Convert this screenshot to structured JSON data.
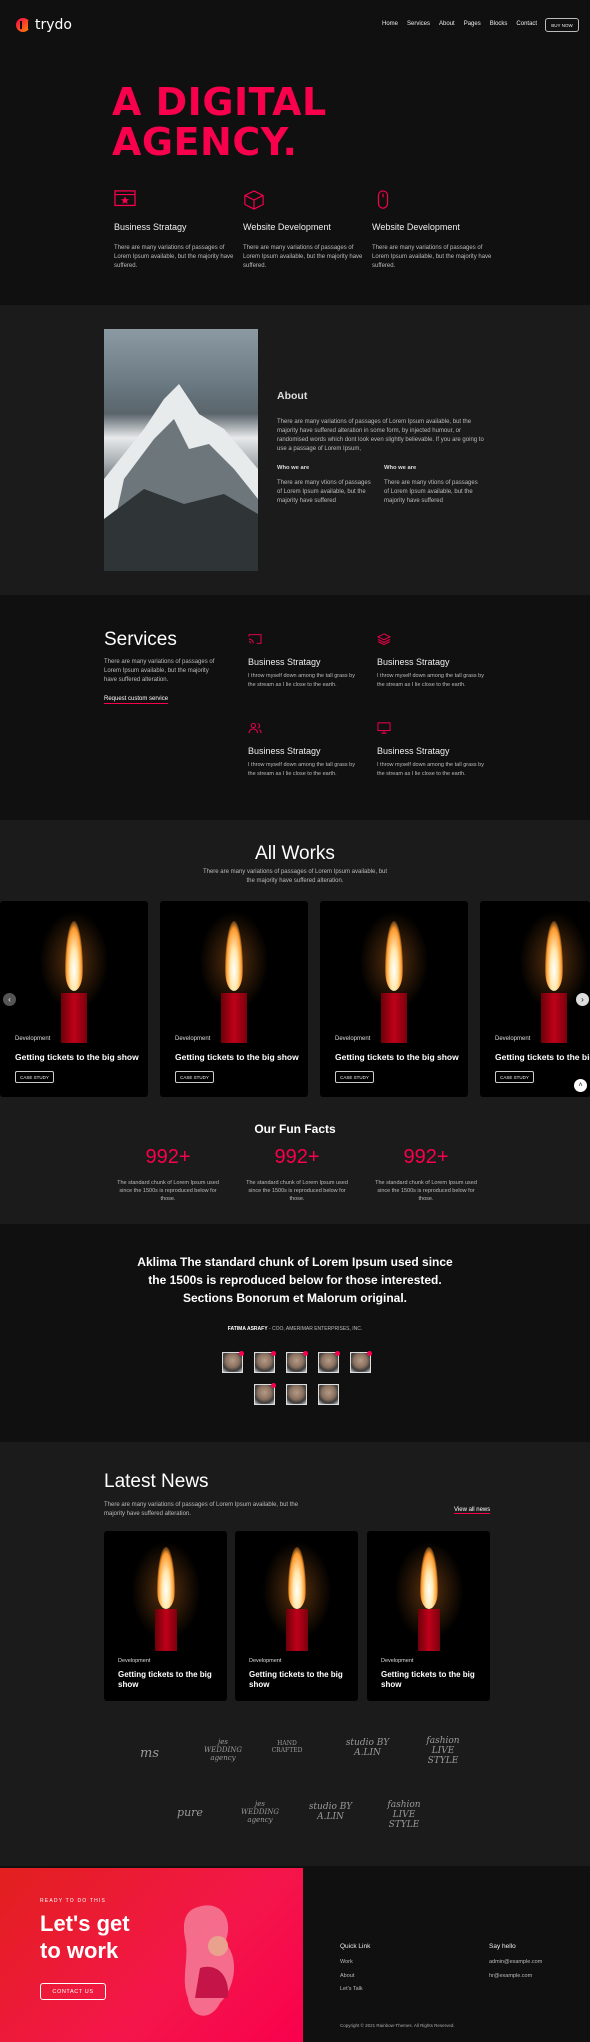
{
  "brand": {
    "logo_text": "trydo",
    "accent": "#f9004d"
  },
  "nav": {
    "items": [
      "Home",
      "Services",
      "About",
      "Pages",
      "Blocks",
      "Contact"
    ],
    "cta": "BUY NOW"
  },
  "hero": {
    "title_line1": "A DIGITAL",
    "title_line2": "AGENCY.",
    "features": [
      {
        "icon": "monitor-star-icon",
        "title": "Business Stratagy",
        "text": "There are many variations of passages of Lorem Ipsum available, but the majority have suffered."
      },
      {
        "icon": "cube-icon",
        "title": "Website Development",
        "text": "There are many variations of passages of Lorem Ipsum available, but the majority have suffered."
      },
      {
        "icon": "mouse-icon",
        "title": "Website Development",
        "text": "There are many variations of passages of Lorem Ipsum available, but the majority have suffered."
      }
    ]
  },
  "about": {
    "title": "About",
    "text": "There are many variations of passages of Lorem Ipsum available, but the majority have suffered alteration in some form, by injected humour, or randomised words which dont look even slightly believable. If you are going to use a passage of Lorem Ipsum,",
    "cols": [
      {
        "title": "Who we are",
        "text": "There are many vtions of passages of Lorem Ipsum available, but the majority have suffered"
      },
      {
        "title": "Who we are",
        "text": "There are many vtions of passages of Lorem Ipsum available, but the majority have suffered"
      }
    ]
  },
  "services": {
    "title": "Services",
    "text": "There are many variations of passages of Lorem Ipsum available, but the majority have suffered alteration.",
    "link": "Request custom service",
    "items": [
      {
        "icon": "cast-icon",
        "title": "Business Stratagy",
        "text": "I throw myself down among the tall grass by the stream as I lie close to the earth."
      },
      {
        "icon": "layers-icon",
        "title": "Business Stratagy",
        "text": "I throw myself down among the tall grass by the stream as I lie close to the earth."
      },
      {
        "icon": "users-icon",
        "title": "Business Stratagy",
        "text": "I throw myself down among the tall grass by the stream as I lie close to the earth."
      },
      {
        "icon": "monitor-icon",
        "title": "Business Stratagy",
        "text": "I throw myself down among the tall grass by the stream as I lie close to the earth."
      }
    ]
  },
  "works": {
    "title": "All Works",
    "text": "There are many variations of passages of Lorem Ipsum available, but the majority have suffered alteration.",
    "cards": [
      {
        "category": "Development",
        "title": "Getting tickets to the big show",
        "button": "CASE STUDY"
      },
      {
        "category": "Development",
        "title": "Getting tickets to the big show",
        "button": "CASE STUDY"
      },
      {
        "category": "Development",
        "title": "Getting tickets to the big show",
        "button": "CASE STUDY"
      },
      {
        "category": "Development",
        "title": "Getting tickets to the big s",
        "button": "CASE STUDY"
      }
    ]
  },
  "facts": {
    "title": "Our Fun Facts",
    "items": [
      {
        "value": "992+",
        "text": "The standard chunk of Lorem Ipsum used since the 1500s is reproduced below for those."
      },
      {
        "value": "992+",
        "text": "The standard chunk of Lorem Ipsum used since the 1500s is reproduced below for those."
      },
      {
        "value": "992+",
        "text": "The standard chunk of Lorem Ipsum used since the 1500s is reproduced below for those."
      }
    ]
  },
  "testimonial": {
    "quote": "Aklima The standard chunk of Lorem Ipsum used since the 1500s is reproduced below for those interested. Sections Bonorum et Malorum original.",
    "author": "FATIMA ASRAFY",
    "role": " - COO, AMERIMAR ENTERPRISES, INC."
  },
  "news": {
    "title": "Latest News",
    "text": "There are many variations of passages of Lorem Ipsum available, but the majority have suffered alteration.",
    "view_all": "View all news",
    "cards": [
      {
        "category": "Development",
        "title": "Getting tickets to the big show"
      },
      {
        "category": "Development",
        "title": "Getting tickets to the big show"
      },
      {
        "category": "Development",
        "title": "Getting tickets to the big show"
      }
    ]
  },
  "brands": {
    "row1": [
      "ms",
      "jes WEDDING agency",
      "HAND CRAFTED",
      "studio BY A.LIN",
      "fashion LIVE STYLE"
    ],
    "row2": [
      "pure",
      "jes WEDDING agency",
      "studio BY A.LIN",
      "fashion LIVE STYLE"
    ]
  },
  "cta": {
    "ready": "READY TO DO THIS",
    "line1": "Let's get",
    "line2": "to work",
    "button": "CONTACT US"
  },
  "footer": {
    "quick_title": "Quick Link",
    "links": [
      "Work",
      "About",
      "Let's Talk"
    ],
    "say_title": "Say hello",
    "emails": [
      "admin@example.com",
      "hr@example.com"
    ],
    "copyright": "Copyright © 2021 Rainbow-Themes. All Rights Reserved."
  }
}
